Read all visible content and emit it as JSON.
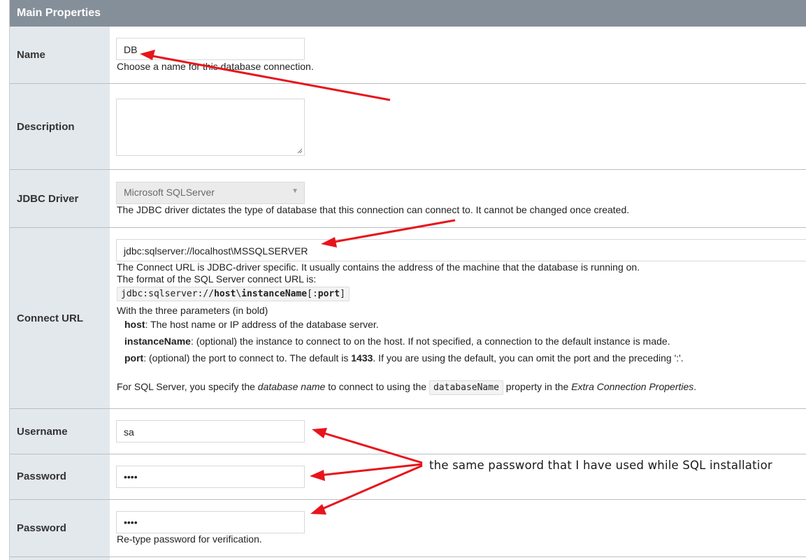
{
  "header": {
    "title": "Main Properties"
  },
  "rows": {
    "name": {
      "label": "Name",
      "value": "DB",
      "help": "Choose a name for this database connection."
    },
    "description": {
      "label": "Description",
      "value": ""
    },
    "jdbc_driver": {
      "label": "JDBC Driver",
      "selected": "Microsoft SQLServer",
      "help": "The JDBC driver dictates the type of database that this connection can connect to. It cannot be changed once created."
    },
    "connect_url": {
      "label": "Connect URL",
      "value": "jdbc:sqlserver://localhost\\MSSQLSERVER",
      "help_line1": "The Connect URL is JDBC-driver specific. It usually contains the address of the machine that the database is running on.",
      "help_line2": "The format of the SQL Server connect URL is:",
      "format_prefix": "jdbc:sqlserver://",
      "format_host": "host",
      "format_sep": "\\",
      "format_instance": "instanceName",
      "format_bracket_open": "[:",
      "format_port": "port",
      "format_bracket_close": "]",
      "params_intro": "With the three parameters (in bold)",
      "param_host_name": "host",
      "param_host_desc": ": The host name or IP address of the database server.",
      "param_instance_name": "instanceName",
      "param_instance_desc": ": (optional) the instance to connect to on the host. If not specified, a connection to the default instance is made.",
      "param_port_name": "port",
      "param_port_desc_a": ": (optional) the port to connect to. The default is ",
      "param_port_default": "1433",
      "param_port_desc_b": ". If you are using the default, you can omit the port and the preceding ':'.",
      "footer_a": "For SQL Server, you specify the ",
      "footer_em1": "database name",
      "footer_b": " to connect to using the ",
      "footer_code": "databaseName",
      "footer_c": " property in the ",
      "footer_em2": "Extra Connection Properties",
      "footer_d": "."
    },
    "username": {
      "label": "Username",
      "value": "sa"
    },
    "password": {
      "label": "Password",
      "value": "••••"
    },
    "password_confirm": {
      "label": "Password",
      "value": "••••",
      "help": "Re-type password for verification."
    }
  },
  "annotation": {
    "text": "the same password that I have used while SQL installatior",
    "arrow_color": "#e8141b"
  }
}
